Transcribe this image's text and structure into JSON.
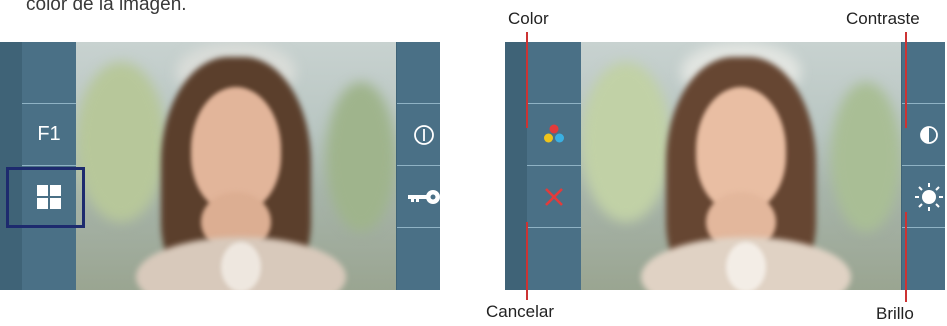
{
  "caption": "color de la imagen.",
  "left_screen": {
    "buttons": {
      "f1_label": "F1"
    }
  },
  "right_screen": {
    "callouts": {
      "color": "Color",
      "contraste": "Contraste",
      "cancelar": "Cancelar",
      "brillo": "Brillo"
    }
  },
  "colors": {
    "panel": "#4a7086",
    "bezel": "#3f6377",
    "highlight": "#1d2a6e",
    "accent_red": "#e23b3b",
    "callout_line": "#cc3333"
  },
  "icons": [
    "power-icon",
    "key-icon",
    "grid-icon",
    "color-dots-icon",
    "cancel-x-icon",
    "contrast-icon",
    "brightness-icon"
  ]
}
